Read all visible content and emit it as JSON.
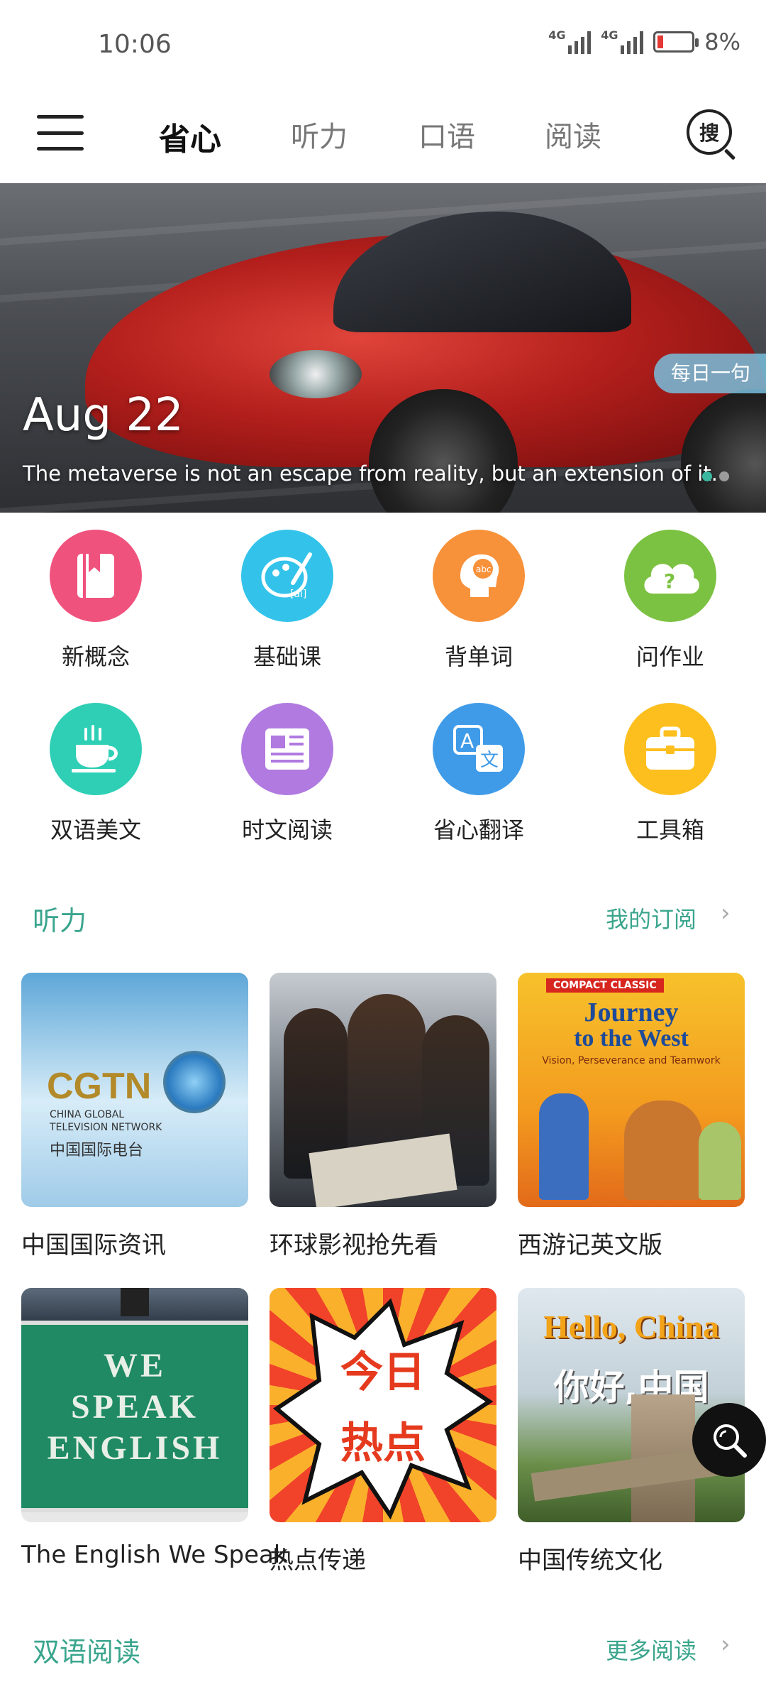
{
  "status_bar": {
    "time": "10:06",
    "battery": "8%",
    "network_1": "4G",
    "network_2": "4G"
  },
  "nav": {
    "tabs": [
      {
        "label": "省心",
        "active": true
      },
      {
        "label": "听力",
        "active": false
      },
      {
        "label": "口语",
        "active": false
      },
      {
        "label": "阅读",
        "active": false
      }
    ],
    "search_label": "搜"
  },
  "banner": {
    "date": "Aug 22",
    "quote": "The metaverse is not an escape from reality, but an extension of it.",
    "badge": "每日一句",
    "page_count": 2,
    "active_page": 1
  },
  "features": [
    {
      "label": "新概念",
      "icon": "bookmark-book-icon",
      "color": "#f0527e"
    },
    {
      "label": "基础课",
      "icon": "palette-brush-icon",
      "color": "#33c3ea"
    },
    {
      "label": "背单词",
      "icon": "head-abc-icon",
      "color": "#f7913a"
    },
    {
      "label": "问作业",
      "icon": "cloud-question-icon",
      "color": "#7cc242"
    },
    {
      "label": "双语美文",
      "icon": "coffee-cup-icon",
      "color": "#2ecfb5"
    },
    {
      "label": "时文阅读",
      "icon": "newspaper-icon",
      "color": "#b07ae0"
    },
    {
      "label": "省心翻译",
      "icon": "translate-icon",
      "color": "#3f9be8"
    },
    {
      "label": "工具箱",
      "icon": "toolbox-icon",
      "color": "#fcbf1e"
    }
  ],
  "listening": {
    "title": "听力",
    "link": "我的订阅",
    "items": [
      {
        "label": "中国国际资讯",
        "image_text": [
          "CGTN",
          "CHINA GLOBAL",
          "TELEVISION NETWORK",
          "中国国际电台"
        ]
      },
      {
        "label": "环球影视抢先看",
        "image_text": []
      },
      {
        "label": "西游记英文版",
        "image_text": [
          "COMPACT CLASSIC",
          "Journey",
          "to the West",
          "Vision, Perseverance and Teamwork"
        ]
      },
      {
        "label": "The English We Speak",
        "image_text": [
          "WE",
          "SPEAK",
          "ENGLISH"
        ]
      },
      {
        "label": "热点传递",
        "image_text": [
          "今日",
          "热点"
        ]
      },
      {
        "label": "中国传统文化",
        "image_text": [
          "Hello, China",
          "你好,中国"
        ]
      }
    ]
  },
  "bilingual": {
    "title": "双语阅读",
    "link": "更多阅读"
  },
  "colors": {
    "accent": "#3aa58d"
  }
}
